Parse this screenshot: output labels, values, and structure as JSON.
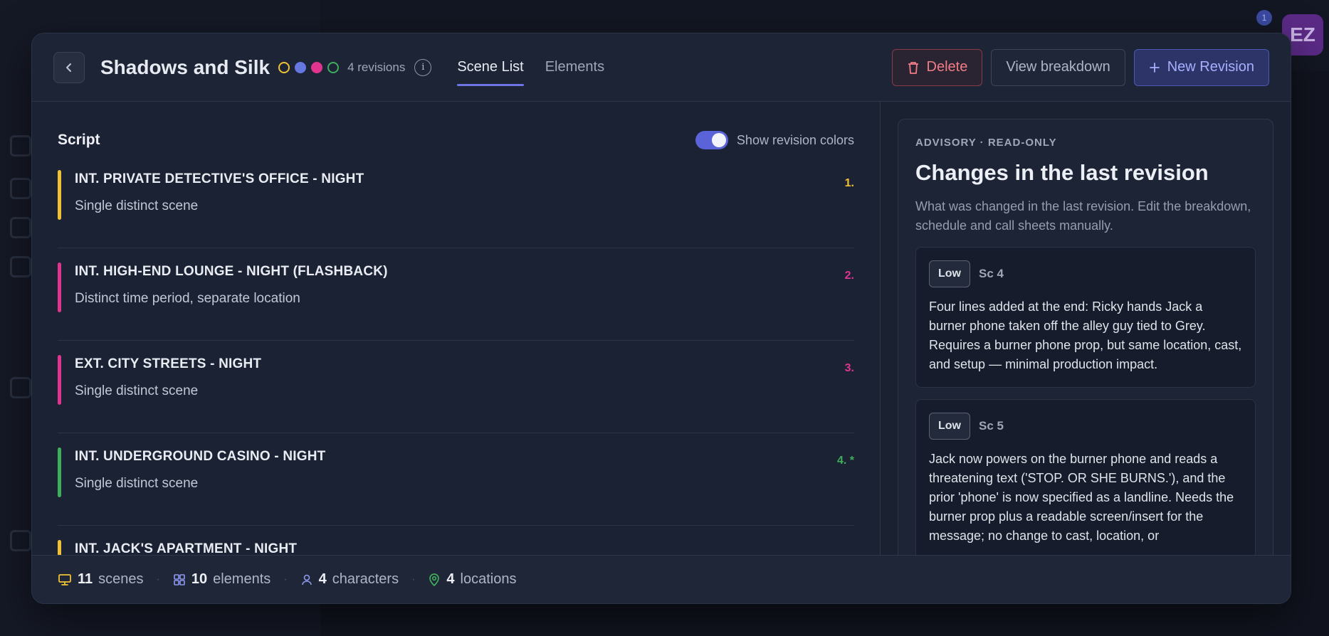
{
  "background": {
    "avatar_initials": "EZ",
    "notification_count": "1"
  },
  "header": {
    "title": "Shadows and Silk",
    "revision_colors": [
      "#f0c233",
      "#6478e0",
      "#e0358f",
      "#3fae5a"
    ],
    "revision_count": "4 revisions",
    "tabs": [
      {
        "label": "Scene List",
        "active": true
      },
      {
        "label": "Elements",
        "active": false
      }
    ],
    "delete_label": "Delete",
    "view_label": "View breakdown",
    "new_label": "New Revision"
  },
  "script": {
    "title": "Script",
    "toggle_label": "Show revision colors",
    "toggle_on": true,
    "scenes": [
      {
        "heading": "INT. PRIVATE DETECTIVE'S OFFICE - NIGHT",
        "desc": "Single distinct scene",
        "num": "1.",
        "color": "#f0c233"
      },
      {
        "heading": "INT. HIGH-END LOUNGE - NIGHT (FLASHBACK)",
        "desc": "Distinct time period, separate location",
        "num": "2.",
        "color": "#e0358f"
      },
      {
        "heading": "EXT. CITY STREETS - NIGHT",
        "desc": "Single distinct scene",
        "num": "3.",
        "color": "#e0358f"
      },
      {
        "heading": "INT. UNDERGROUND CASINO - NIGHT",
        "desc": "Single distinct scene",
        "num": "4. *",
        "color": "#3fae5a"
      },
      {
        "heading": "INT. JACK'S APARTMENT - NIGHT",
        "desc": "",
        "num": "",
        "color": "#f0c233"
      }
    ]
  },
  "advisory": {
    "label": "ADVISORY · READ-ONLY",
    "title": "Changes in the last revision",
    "subtitle": "What was changed in the last revision. Edit the breakdown, schedule and call sheets manually.",
    "changes": [
      {
        "severity": "Low",
        "scene": "Sc 4",
        "text": "Four lines added at the end: Ricky hands Jack a burner phone taken off the alley guy tied to Grey. Requires a burner phone prop, but same location, cast, and setup — minimal production impact."
      },
      {
        "severity": "Low",
        "scene": "Sc 5",
        "text": "Jack now powers on the burner phone and reads a threatening text ('STOP. OR SHE BURNS.'), and the prior 'phone' is now specified as a landline. Needs the burner prop plus a readable screen/insert for the message; no change to cast, location, or"
      }
    ]
  },
  "footer": {
    "scenes_count": "11",
    "scenes_label": "scenes",
    "elements_count": "10",
    "elements_label": "elements",
    "characters_count": "4",
    "characters_label": "characters",
    "locations_count": "4",
    "locations_label": "locations"
  }
}
